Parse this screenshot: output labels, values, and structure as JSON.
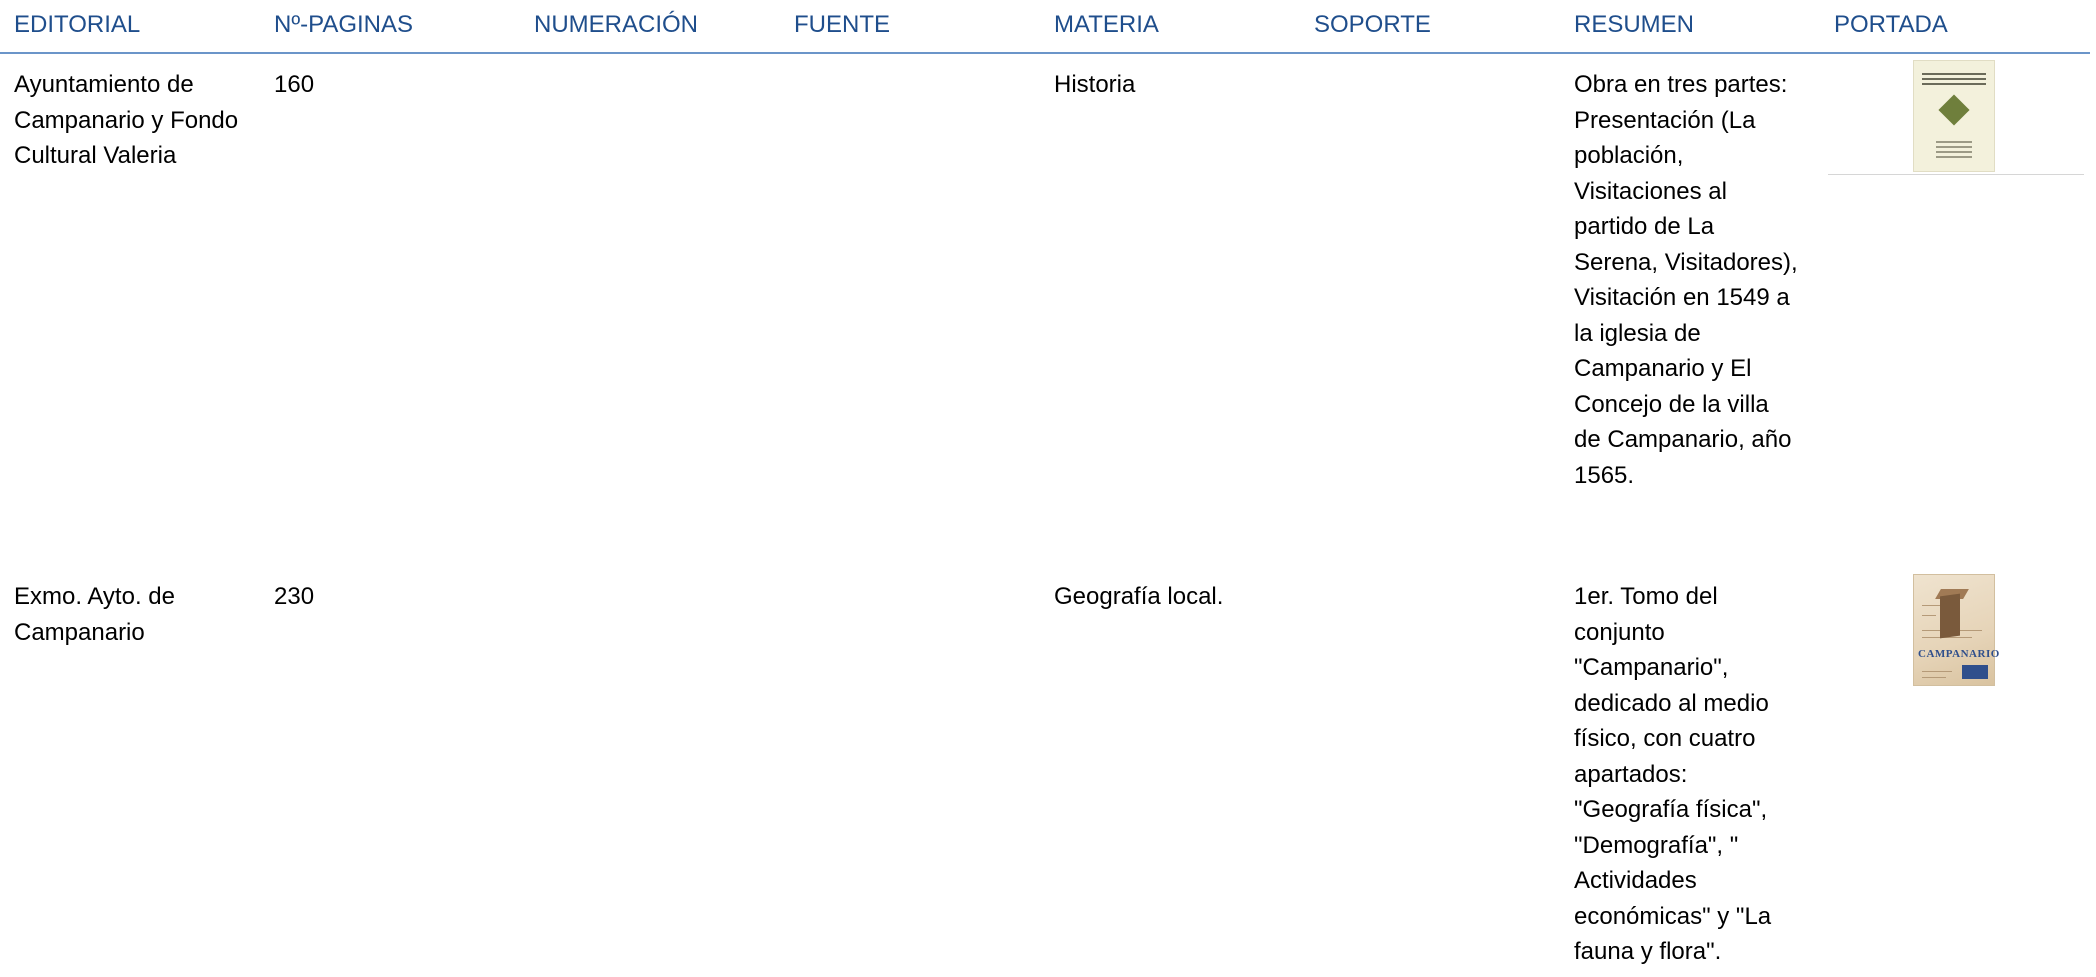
{
  "header": {
    "editorial": "EDITORIAL",
    "paginas": "Nº-PAGINAS",
    "numeracion": "NUMERACIÓN",
    "fuente": "FUENTE",
    "materia": "MATERIA",
    "soporte": "SOPORTE",
    "resumen": "RESUMEN",
    "portada": "PORTADA"
  },
  "colors": {
    "header_text": "#1f4e8c",
    "header_rule": "#6b95c9"
  },
  "rows": [
    {
      "editorial": "Ayuntamiento de Campanario y Fondo Cultural Valeria",
      "paginas": "160",
      "numeracion": "",
      "fuente": "",
      "materia": "Historia",
      "soporte": "",
      "resumen": "Obra en tres partes: Presentación (La población, Visitaciones al partido de La Serena, Visitadores), Visitación en 1549 a la iglesia de Campanario y El Concejo de la villa de Campanario, año 1565.",
      "portada": "book-cover-image"
    },
    {
      "editorial": "Exmo. Ayto. de Campanario",
      "paginas": "230",
      "numeracion": "",
      "fuente": "",
      "materia": "Geografía local.",
      "soporte": "",
      "resumen": "1er. Tomo del conjunto \"Campanario\", dedicado al medio físico, con cuatro apartados: \"Geografía física\", \"Demografía\", \" Actividades económicas\" y \"La fauna y flora\".",
      "portada": "book-cover-image",
      "portada_title": "CAMPANARIO"
    }
  ]
}
